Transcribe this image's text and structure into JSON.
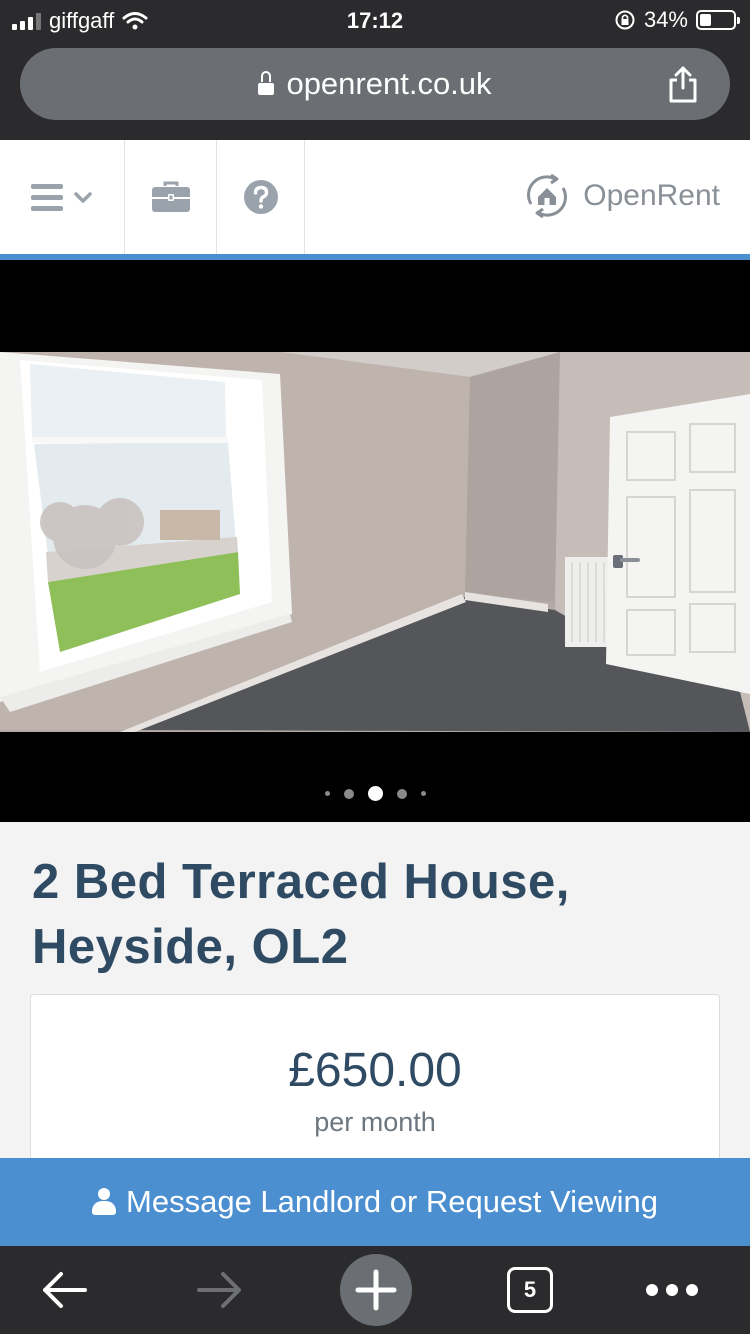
{
  "status_bar": {
    "carrier": "giffgaff",
    "time": "17:12",
    "battery": "34%",
    "battery_level": 0.34
  },
  "browser": {
    "url": "openrent.co.uk",
    "tab_count": "5"
  },
  "site_header": {
    "brand_name": "OpenRent",
    "nav_icons": [
      "menu-icon",
      "chevron-down-icon",
      "briefcase-icon",
      "help-icon"
    ]
  },
  "carousel": {
    "dot_count": 5,
    "active_index": 2
  },
  "listing": {
    "title_line1": "2 Bed Terraced House,",
    "title_line2": "Heyside, OL2",
    "price": "£650.00",
    "period": "per month"
  },
  "action": {
    "label": "Message Landlord or Request Viewing"
  },
  "colors": {
    "accent_blue": "#4b8fd1",
    "title_navy": "#2f4a63",
    "chrome_dark": "#2b2b2d"
  }
}
